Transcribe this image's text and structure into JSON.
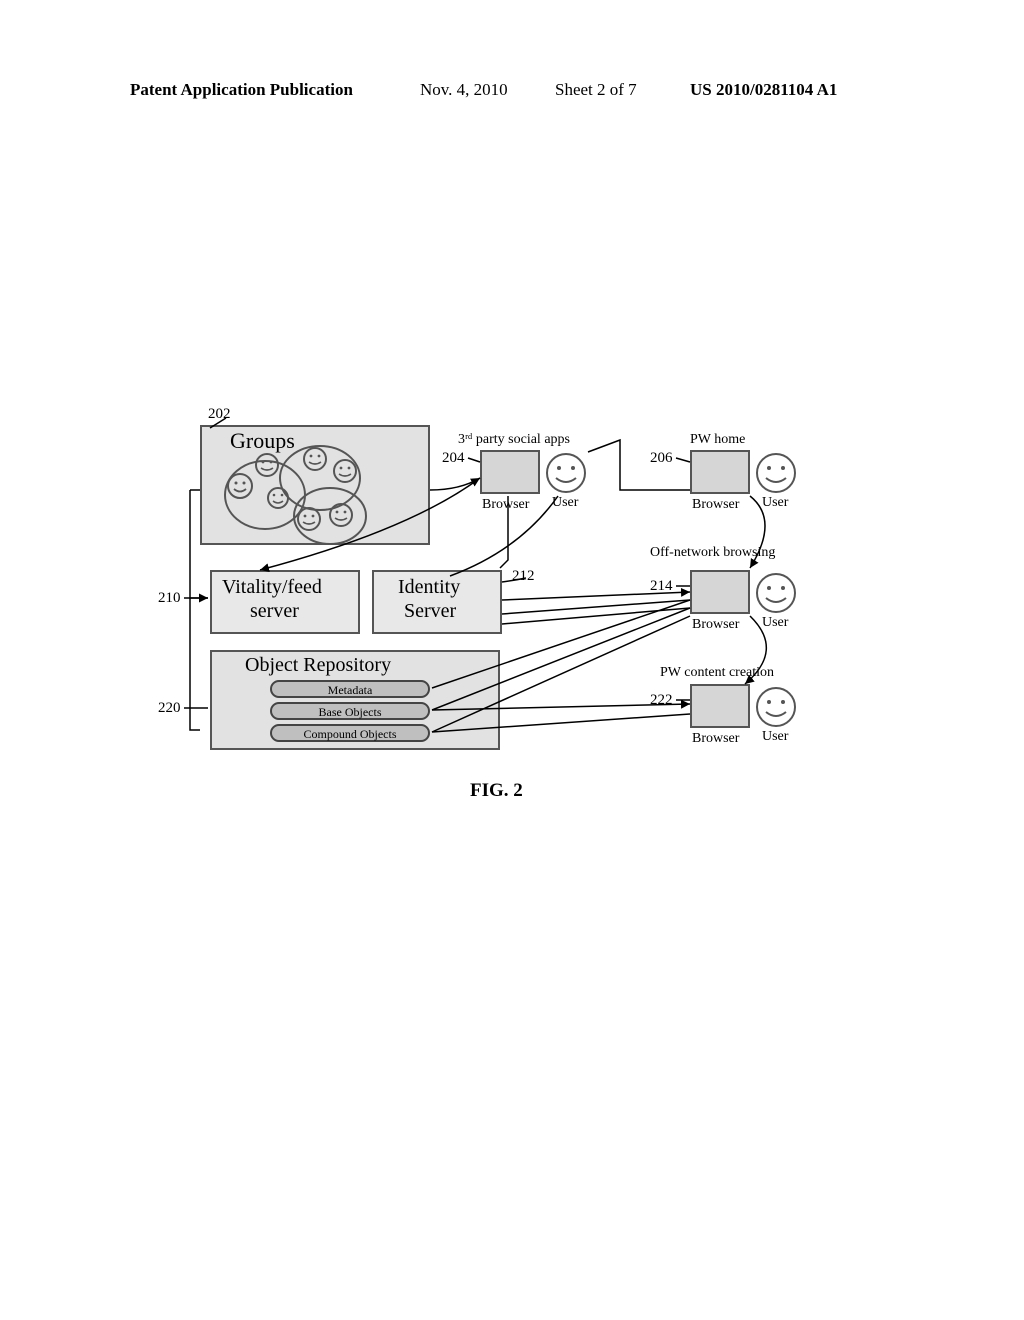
{
  "header": {
    "pub": "Patent Application Publication",
    "date": "Nov. 4, 2010",
    "sheet": "Sheet 2 of 7",
    "patnum": "US 2010/0281104 A1"
  },
  "refs": {
    "r202": "202",
    "r204": "204",
    "r206": "206",
    "r210": "210",
    "r212": "212",
    "r214": "214",
    "r220": "220",
    "r222": "222"
  },
  "labels": {
    "groups": "Groups",
    "third_party": "3ʳᵈ party social apps",
    "pw_home": "PW home",
    "off_network": "Off-network browsing",
    "pw_content": "PW content creation",
    "vitality1": "Vitality/feed",
    "vitality2": "server",
    "identity1": "Identity",
    "identity2": "Server",
    "repo_title": "Object Repository",
    "metadata": "Metadata",
    "base": "Base Objects",
    "compound": "Compound Objects",
    "browser": "Browser",
    "user": "User"
  },
  "caption": "FIG. 2"
}
